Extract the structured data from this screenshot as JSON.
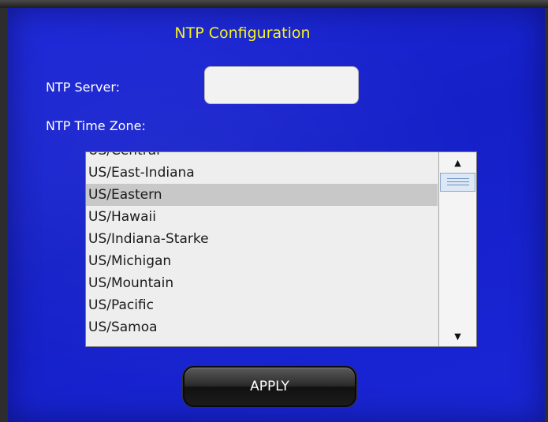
{
  "title": "NTP Configuration",
  "ntp_server": {
    "label": "NTP Server:",
    "value": "",
    "placeholder": ""
  },
  "ntp_time_zone": {
    "label": "NTP Time Zone:",
    "selected": "US/Eastern",
    "options": [
      "US/Central",
      "US/East-Indiana",
      "US/Eastern",
      "US/Hawaii",
      "US/Indiana-Starke",
      "US/Michigan",
      "US/Mountain",
      "US/Pacific",
      "US/Samoa"
    ]
  },
  "scrollbar": {
    "up_icon": "triangle-up",
    "down_icon": "triangle-down"
  },
  "apply_label": "APPLY",
  "colors": {
    "panel_background": "#1a24d0",
    "title": "#f6f31f",
    "label": "#ffffff",
    "selected_row": "#c8c8c8"
  }
}
